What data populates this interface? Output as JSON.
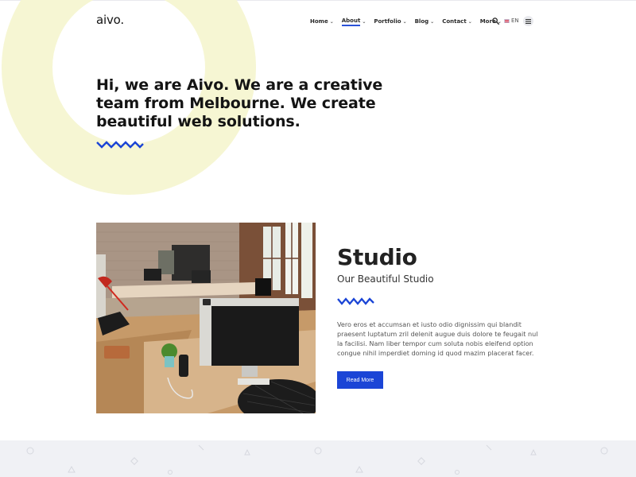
{
  "colors": {
    "ring": "#f5f5d2",
    "accent": "#1b45d6",
    "text_dark": "#141414",
    "band": "#f0f1f5"
  },
  "header": {
    "logo": "aivo.",
    "nav": [
      {
        "label": "Home"
      },
      {
        "label": "About"
      },
      {
        "label": "Portfolio"
      },
      {
        "label": "Blog"
      },
      {
        "label": "Contact"
      },
      {
        "label": "More"
      }
    ],
    "active_nav": "About",
    "search_icon": "search-icon",
    "language": "EN",
    "menu_icon": "hamburger-icon"
  },
  "hero": {
    "title_line1": "Hi, we are Aivo. We are a creative",
    "title_line2": "team from Melbourne. We create",
    "title_line3": "beautiful web solutions."
  },
  "studio": {
    "title": "Studio",
    "subtitle": "Our Beautiful Studio",
    "body_line1": "Vero eros et accumsan et iusto odio dignissim qui blandit",
    "body_line2": "praesent luptatum zril delenit augue duis dolore te feugait nul",
    "body_line3": "la facilisi. Nam liber tempor cum soluta nobis eleifend option",
    "body_line4": "congue nihil imperdiet doming id quod mazim placerat facer.",
    "button": "Read More"
  }
}
